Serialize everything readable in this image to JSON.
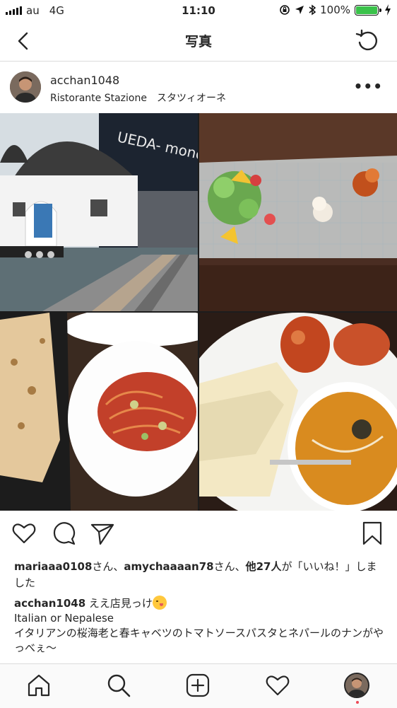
{
  "status_bar": {
    "carrier": "au",
    "network": "4G",
    "time": "11:10",
    "battery_percent": "100%",
    "battery_level": 1.0,
    "icons": [
      "signal-icon",
      "lock-rotation-icon",
      "location-icon",
      "bluetooth-icon",
      "battery-icon",
      "charging-icon"
    ]
  },
  "nav": {
    "title": "写真",
    "back_icon": "chevron-left-icon",
    "refresh_icon": "refresh-icon"
  },
  "post": {
    "username": "acchan1048",
    "location": "Ristorante Stazione　スタツィオーネ",
    "more_label": "•••",
    "photo_tiles": [
      "restaurant-exterior",
      "salad-plate",
      "naan-and-pasta",
      "tandoori-and-curry"
    ]
  },
  "actions": {
    "icons": [
      "heart-icon",
      "comment-icon",
      "share-icon",
      "bookmark-icon"
    ]
  },
  "likes": {
    "user1": "mariaaa0108",
    "san1": "さん、",
    "user2": "amychaaaan78",
    "san2": "さん、",
    "others": "他27人",
    "suffix": "が「いいね！」しました"
  },
  "caption": {
    "user": "acchan1048",
    "text": "ええ店見っけ",
    "line2": "Italian or Nepalese",
    "line3": "イタリアンの桜海老と春キャベツのトマトソースパスタとネパールのナンがやっべぇ〜"
  },
  "tabbar": {
    "icons": [
      "home-icon",
      "search-icon",
      "add-post-icon",
      "activity-heart-icon",
      "profile-avatar"
    ]
  },
  "colors": {
    "text": "#262626",
    "divider": "#dbdbdb",
    "battery": "#3ac24a",
    "notification_dot": "#ed4956"
  }
}
